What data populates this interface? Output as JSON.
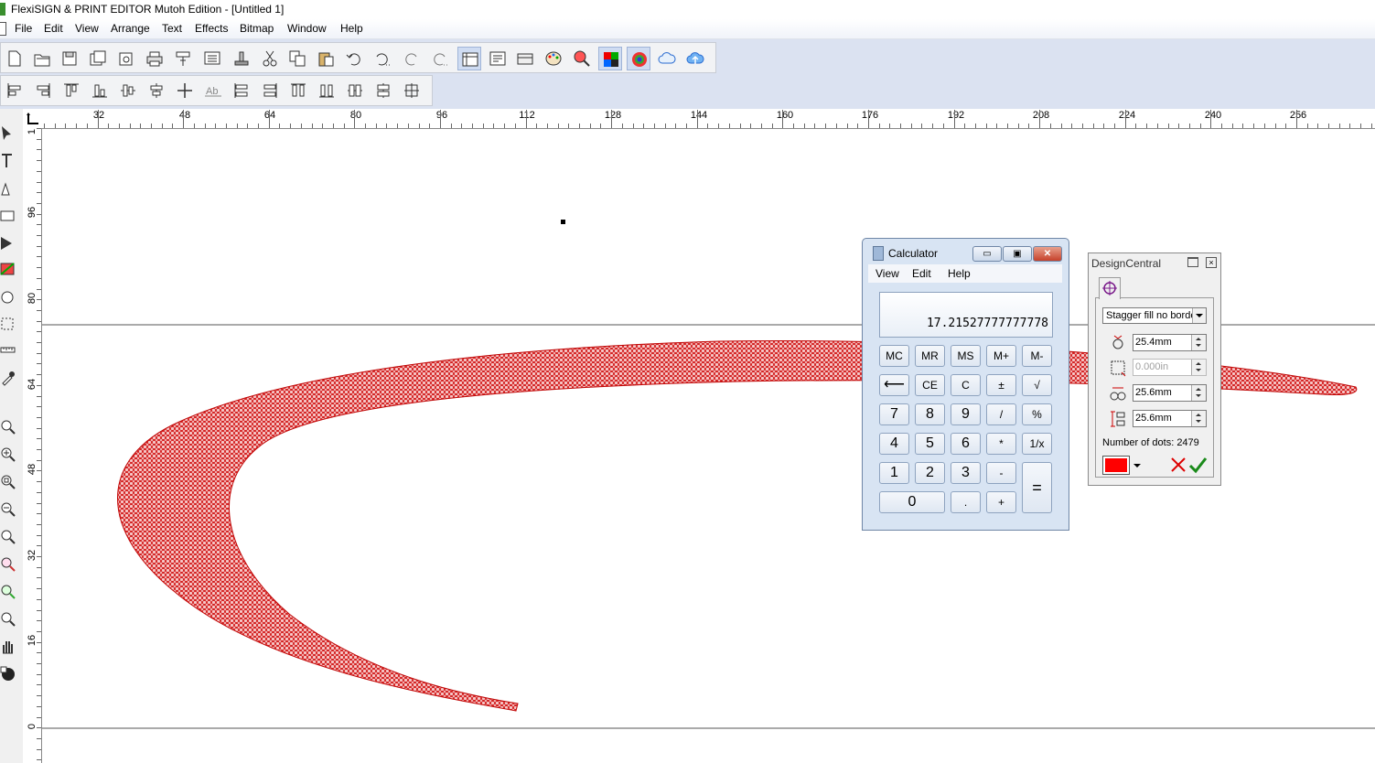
{
  "window": {
    "title": "FlexiSIGN & PRINT EDITOR Mutoh Edition - [Untitled 1]"
  },
  "menu": [
    "File",
    "Edit",
    "View",
    "Arrange",
    "Text",
    "Effects",
    "Bitmap",
    "Window",
    "Help"
  ],
  "ruler": {
    "top_labels": [
      "32",
      "48",
      "64",
      "80",
      "96",
      "112",
      "128",
      "144",
      "160",
      "176",
      "192",
      "208",
      "224",
      "240",
      "256"
    ],
    "left_labels": [
      "1",
      "96",
      "80",
      "64",
      "48",
      "32",
      "16",
      "0"
    ]
  },
  "calculator": {
    "title": "Calculator",
    "menu": [
      "View",
      "Edit",
      "Help"
    ],
    "display": "17.21527777777778",
    "memory_row": [
      "MC",
      "MR",
      "MS",
      "M+",
      "M-"
    ],
    "row2": [
      "⟵",
      "CE",
      "C",
      "±",
      "√"
    ],
    "row3": [
      "7",
      "8",
      "9",
      "/",
      "%"
    ],
    "row4": [
      "4",
      "5",
      "6",
      "*",
      "1/x"
    ],
    "row5": [
      "1",
      "2",
      "3",
      "-"
    ],
    "row6": [
      "0",
      ".",
      "+"
    ],
    "equals": "=",
    "window_buttons": {
      "minimize": "▭",
      "maximize": "▣",
      "close": "✕"
    }
  },
  "design_central": {
    "title": "DesignCentral",
    "fill_type": "Stagger fill no borde",
    "fields": [
      {
        "icon": "dot-size-icon",
        "value": "25.4mm",
        "disabled": false
      },
      {
        "icon": "border-icon",
        "value": "0.000in",
        "disabled": true
      },
      {
        "icon": "horizontal-spacing-icon",
        "value": "25.6mm",
        "disabled": false
      },
      {
        "icon": "vertical-spacing-icon",
        "value": "25.6mm",
        "disabled": false
      }
    ],
    "dots_label": "Number of dots: 2479",
    "color": "#ff0000"
  },
  "colors": {
    "shape_fill": "#e11f1f",
    "toolbar_bg": "#dbe2f1"
  }
}
